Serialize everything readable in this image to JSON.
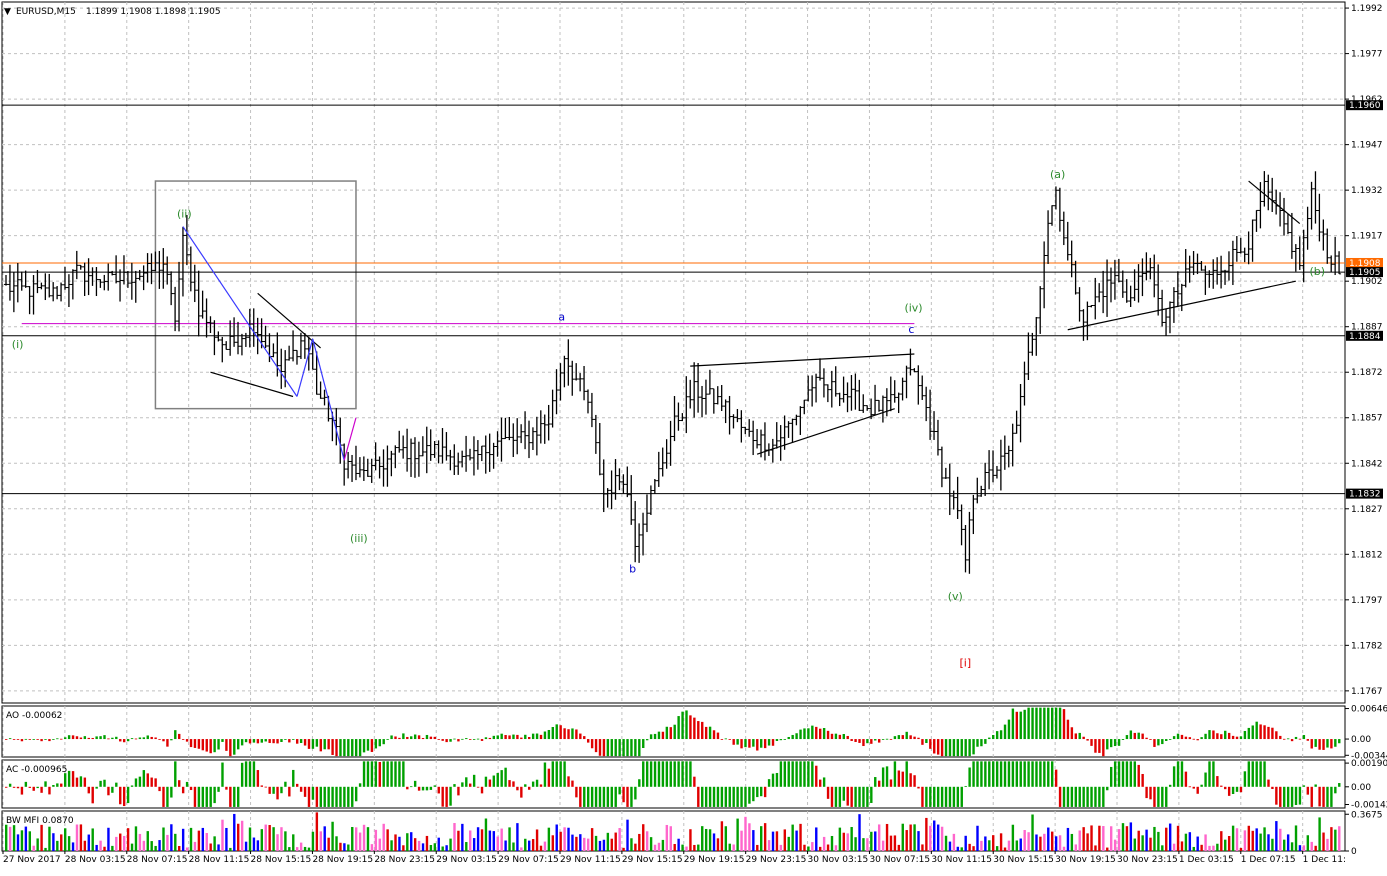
{
  "header": {
    "symbol_timeframe": "EURUSD,M15",
    "ohlc": "1.1899 1.1908 1.1898 1.1905"
  },
  "colors": {
    "grid": "#c0c0c0",
    "bar": "#000000",
    "up": "#00a000",
    "down": "#e00000",
    "bw_blue": "#0000ff",
    "wave_green": "#2e8b2e",
    "wave_blue": "#0000cc",
    "wave_red": "#e00000",
    "hline_orange": "#ff6a00",
    "hline_magenta": "#cc00cc",
    "tagline_blue": "#3a3aff"
  },
  "chart_data": [
    {
      "type": "candlestick",
      "series_style": "ohlc_bars",
      "ylim": [
        1.1763,
        1.1994
      ],
      "y_ticks": [
        "1.1992",
        "1.1977",
        "1.1962",
        "1.1947",
        "1.1932",
        "1.1917",
        "1.1902",
        "1.1887",
        "1.1872",
        "1.1857",
        "1.1842",
        "1.1827",
        "1.1812",
        "1.1797",
        "1.1782",
        "1.1767"
      ],
      "price_levels": [
        {
          "label": "1.1960",
          "value": 1.196,
          "color": "#000000"
        },
        {
          "label": "1.1908",
          "value": 1.1908,
          "color": "#ff6a00"
        },
        {
          "label": "1.1905",
          "value": 1.1905,
          "color": "#000000"
        },
        {
          "label": "1.1884",
          "value": 1.1884,
          "color": "#000000"
        },
        {
          "label": "1.1832",
          "value": 1.1832,
          "color": "#000000"
        }
      ],
      "magenta_level": 1.1888,
      "x_labels": [
        "27 Nov 2017",
        "28 Nov 03:15",
        "28 Nov 07:15",
        "28 Nov 11:15",
        "28 Nov 15:15",
        "28 Nov 19:15",
        "28 Nov 23:15",
        "29 Nov 03:15",
        "29 Nov 07:15",
        "29 Nov 11:15",
        "29 Nov 15:15",
        "29 Nov 19:15",
        "29 Nov 23:15",
        "30 Nov 03:15",
        "30 Nov 07:15",
        "30 Nov 11:15",
        "30 Nov 15:15",
        "30 Nov 19:15",
        "30 Nov 23:15",
        "1 Dec 03:15",
        "1 Dec 07:15",
        "1 Dec 11:"
      ],
      "bar_count": 340,
      "anchors": [
        [
          0,
          1.19
        ],
        [
          12,
          1.1898
        ],
        [
          18,
          1.1905
        ],
        [
          27,
          1.1902
        ],
        [
          36,
          1.1905
        ],
        [
          40,
          1.1908
        ],
        [
          43,
          1.189
        ],
        [
          45,
          1.1915
        ],
        [
          49,
          1.1893
        ],
        [
          53,
          1.1885
        ],
        [
          56,
          1.188
        ],
        [
          63,
          1.1888
        ],
        [
          70,
          1.1872
        ],
        [
          75,
          1.1882
        ],
        [
          77,
          1.1878
        ],
        [
          79,
          1.1866
        ],
        [
          83,
          1.1856
        ],
        [
          86,
          1.1843
        ],
        [
          90,
          1.1838
        ],
        [
          94,
          1.184
        ],
        [
          100,
          1.1846
        ],
        [
          110,
          1.1846
        ],
        [
          118,
          1.1842
        ],
        [
          124,
          1.1849
        ],
        [
          132,
          1.185
        ],
        [
          138,
          1.1856
        ],
        [
          142,
          1.1878
        ],
        [
          144,
          1.1872
        ],
        [
          148,
          1.1862
        ],
        [
          152,
          1.1832
        ],
        [
          157,
          1.1838
        ],
        [
          160,
          1.1817
        ],
        [
          165,
          1.1835
        ],
        [
          170,
          1.1855
        ],
        [
          175,
          1.1866
        ],
        [
          182,
          1.1862
        ],
        [
          188,
          1.1852
        ],
        [
          195,
          1.1848
        ],
        [
          200,
          1.1856
        ],
        [
          205,
          1.1868
        ],
        [
          212,
          1.1866
        ],
        [
          220,
          1.186
        ],
        [
          226,
          1.1862
        ],
        [
          230,
          1.1874
        ],
        [
          234,
          1.186
        ],
        [
          238,
          1.184
        ],
        [
          242,
          1.1825
        ],
        [
          244,
          1.181
        ],
        [
          246,
          1.1832
        ],
        [
          250,
          1.1838
        ],
        [
          255,
          1.1845
        ],
        [
          258,
          1.1862
        ],
        [
          262,
          1.1892
        ],
        [
          265,
          1.1922
        ],
        [
          267,
          1.1932
        ],
        [
          270,
          1.191
        ],
        [
          274,
          1.189
        ],
        [
          278,
          1.1898
        ],
        [
          282,
          1.1903
        ],
        [
          286,
          1.1896
        ],
        [
          290,
          1.1908
        ],
        [
          294,
          1.189
        ],
        [
          297,
          1.1896
        ],
        [
          302,
          1.1908
        ],
        [
          306,
          1.1903
        ],
        [
          310,
          1.1908
        ],
        [
          316,
          1.1915
        ],
        [
          320,
          1.1932
        ],
        [
          325,
          1.192
        ],
        [
          329,
          1.1908
        ],
        [
          332,
          1.193
        ],
        [
          336,
          1.1912
        ],
        [
          339,
          1.1905
        ]
      ],
      "wave_labels": [
        {
          "text": "(i)",
          "bar": 3,
          "price": 1.188,
          "color": "#2e8b2e"
        },
        {
          "text": "(ii)",
          "bar": 45,
          "price": 1.1923,
          "color": "#2e8b2e"
        },
        {
          "text": "(iii)",
          "bar": 89,
          "price": 1.1816,
          "color": "#2e8b2e"
        },
        {
          "text": "a",
          "bar": 142,
          "price": 1.1889,
          "color": "#0000cc"
        },
        {
          "text": "b",
          "bar": 160,
          "price": 1.1806,
          "color": "#0000cc"
        },
        {
          "text": "(iv)",
          "bar": 230,
          "price": 1.1892,
          "color": "#2e8b2e"
        },
        {
          "text": "c",
          "bar": 231,
          "price": 1.1885,
          "color": "#0000cc"
        },
        {
          "text": "(v)",
          "bar": 241,
          "price": 1.1797,
          "color": "#2e8b2e"
        },
        {
          "text": "[i]",
          "bar": 244,
          "price": 1.1775,
          "color": "#e00000"
        },
        {
          "text": "(a)",
          "bar": 267,
          "price": 1.1936,
          "color": "#2e8b2e"
        },
        {
          "text": "(b)",
          "bar": 333,
          "price": 1.1904,
          "color": "#2e8b2e"
        }
      ],
      "trendlines": [
        {
          "from": [
            52,
            1.1872
          ],
          "to": [
            73,
            1.1864
          ],
          "color": "#000000"
        },
        {
          "from": [
            64,
            1.1898
          ],
          "to": [
            80,
            1.188
          ],
          "color": "#000000"
        },
        {
          "from": [
            174,
            1.1874
          ],
          "to": [
            231,
            1.1878
          ],
          "color": "#000000"
        },
        {
          "from": [
            191,
            1.1845
          ],
          "to": [
            226,
            1.186
          ],
          "color": "#000000"
        },
        {
          "from": [
            270,
            1.1886
          ],
          "to": [
            328,
            1.1902
          ],
          "color": "#000000"
        },
        {
          "from": [
            316,
            1.1935
          ],
          "to": [
            329,
            1.1921
          ],
          "color": "#000000"
        },
        {
          "from": [
            45,
            1.192
          ],
          "to": [
            74,
            1.1864
          ],
          "color": "#3a3aff"
        },
        {
          "from": [
            74,
            1.1864
          ],
          "to": [
            78,
            1.1883
          ],
          "color": "#3a3aff"
        },
        {
          "from": [
            78,
            1.1883
          ],
          "to": [
            86,
            1.1843
          ],
          "color": "#3a3aff"
        },
        {
          "from": [
            86,
            1.1843
          ],
          "to": [
            89,
            1.1857
          ],
          "color": "#cc00cc"
        }
      ],
      "rectangle": {
        "bar_from": 38,
        "bar_to": 89,
        "price_top": 1.1935,
        "price_bottom": 1.186,
        "color": "#808080"
      }
    },
    {
      "type": "bar",
      "name": "AO -0.00062",
      "y_ticks": [
        "0.00646",
        "0.00",
        "-0.00344"
      ],
      "ylim": [
        -0.0038,
        0.007
      ],
      "value_text": "AO -0.00062"
    },
    {
      "type": "bar",
      "name": "AC -0.000965",
      "y_ticks": [
        "0.001901",
        "0.00",
        "-0.00142"
      ],
      "ylim": [
        -0.0017,
        0.00215
      ],
      "value_text": "AC -0.000965"
    },
    {
      "type": "bar",
      "name": "BW MFI 0.0870",
      "y_ticks": [
        "0.3675",
        "0"
      ],
      "ylim": [
        0,
        0.4
      ],
      "value_text": "BW MFI 0.0870"
    }
  ]
}
